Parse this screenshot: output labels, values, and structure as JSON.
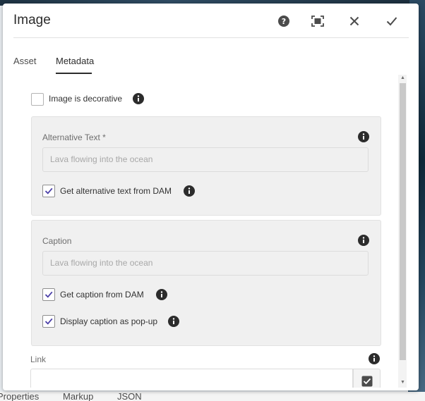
{
  "dialog": {
    "title": "Image",
    "header_buttons": {
      "help_icon": "help-icon",
      "fullscreen_icon": "fullscreen-icon",
      "close_icon": "close-icon",
      "done_icon": "checkmark-icon"
    }
  },
  "tabs": [
    {
      "label": "Asset",
      "active": false
    },
    {
      "label": "Metadata",
      "active": true
    }
  ],
  "metadata": {
    "decorative": {
      "label": "Image is decorative",
      "checked": false
    },
    "alt_text": {
      "label": "Alternative Text *",
      "placeholder": "Lava flowing into the ocean",
      "from_dam": {
        "label": "Get alternative text from DAM",
        "checked": true
      }
    },
    "caption": {
      "label": "Caption",
      "placeholder": "Lava flowing into the ocean",
      "from_dam": {
        "label": "Get caption from DAM",
        "checked": true
      },
      "popup": {
        "label": "Display caption as pop-up",
        "checked": true
      }
    },
    "link": {
      "label": "Link",
      "value": ""
    }
  },
  "background_tabs": [
    "Properties",
    "Markup",
    "JSON"
  ],
  "colors": {
    "accent_check": "#4b3fa8",
    "info_icon": "#2c2c2c",
    "panel_bg": "#f0f0f0"
  }
}
